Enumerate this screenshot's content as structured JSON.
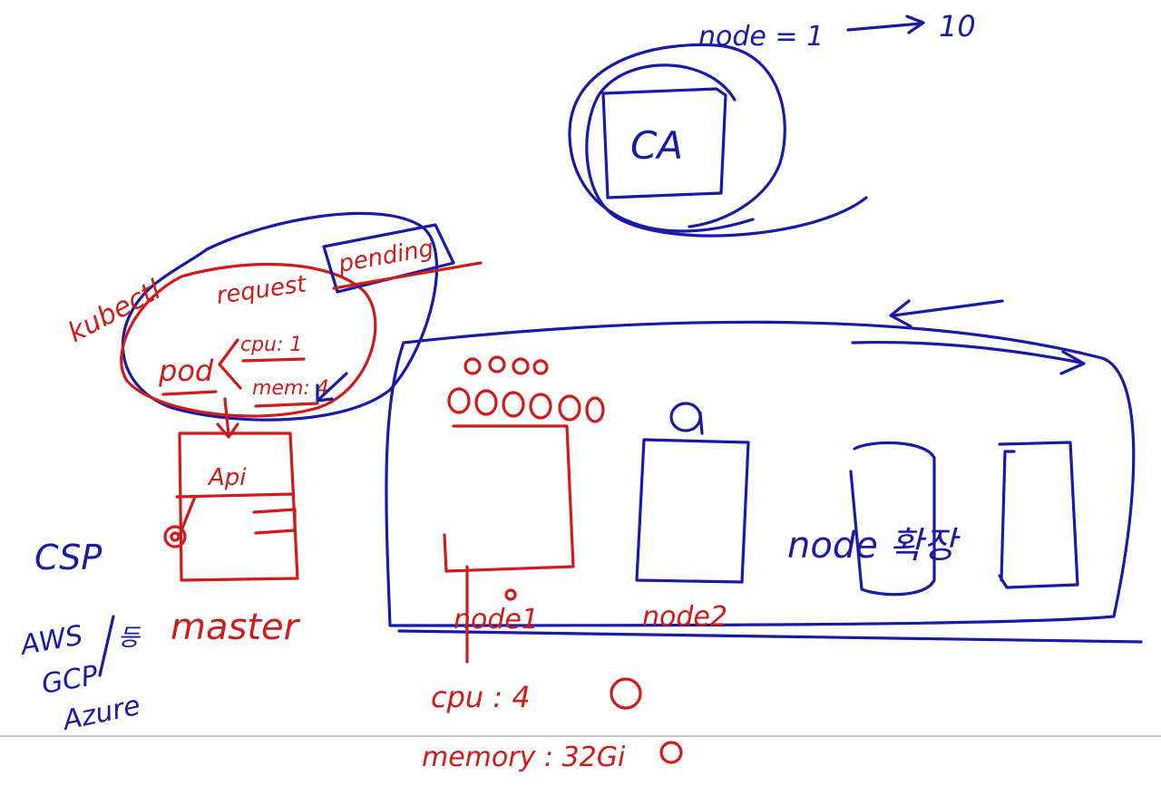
{
  "ca": {
    "node_range_label": "node = 1",
    "node_range_target": "10",
    "box_label": "CA"
  },
  "request": {
    "kubectl": "kubectl",
    "request": "request",
    "pending": "pending",
    "pod": "pod",
    "cpu": "cpu: 1",
    "mem": "mem: 4"
  },
  "master": {
    "api": "Api",
    "label": "master",
    "csp": "CSP",
    "providers": [
      "AWS",
      "GCP",
      "Azure"
    ],
    "suffix": "등"
  },
  "cluster": {
    "nodes": [
      {
        "label": "node1"
      },
      {
        "label": "node2"
      }
    ],
    "add_label": "node 확장",
    "cpu": "cpu : 4",
    "memory": "memory : 32Gi"
  },
  "colors": {
    "blue_ink": "#1a1aa8",
    "red_ink": "#d11a1a",
    "background": "#ffffff"
  }
}
